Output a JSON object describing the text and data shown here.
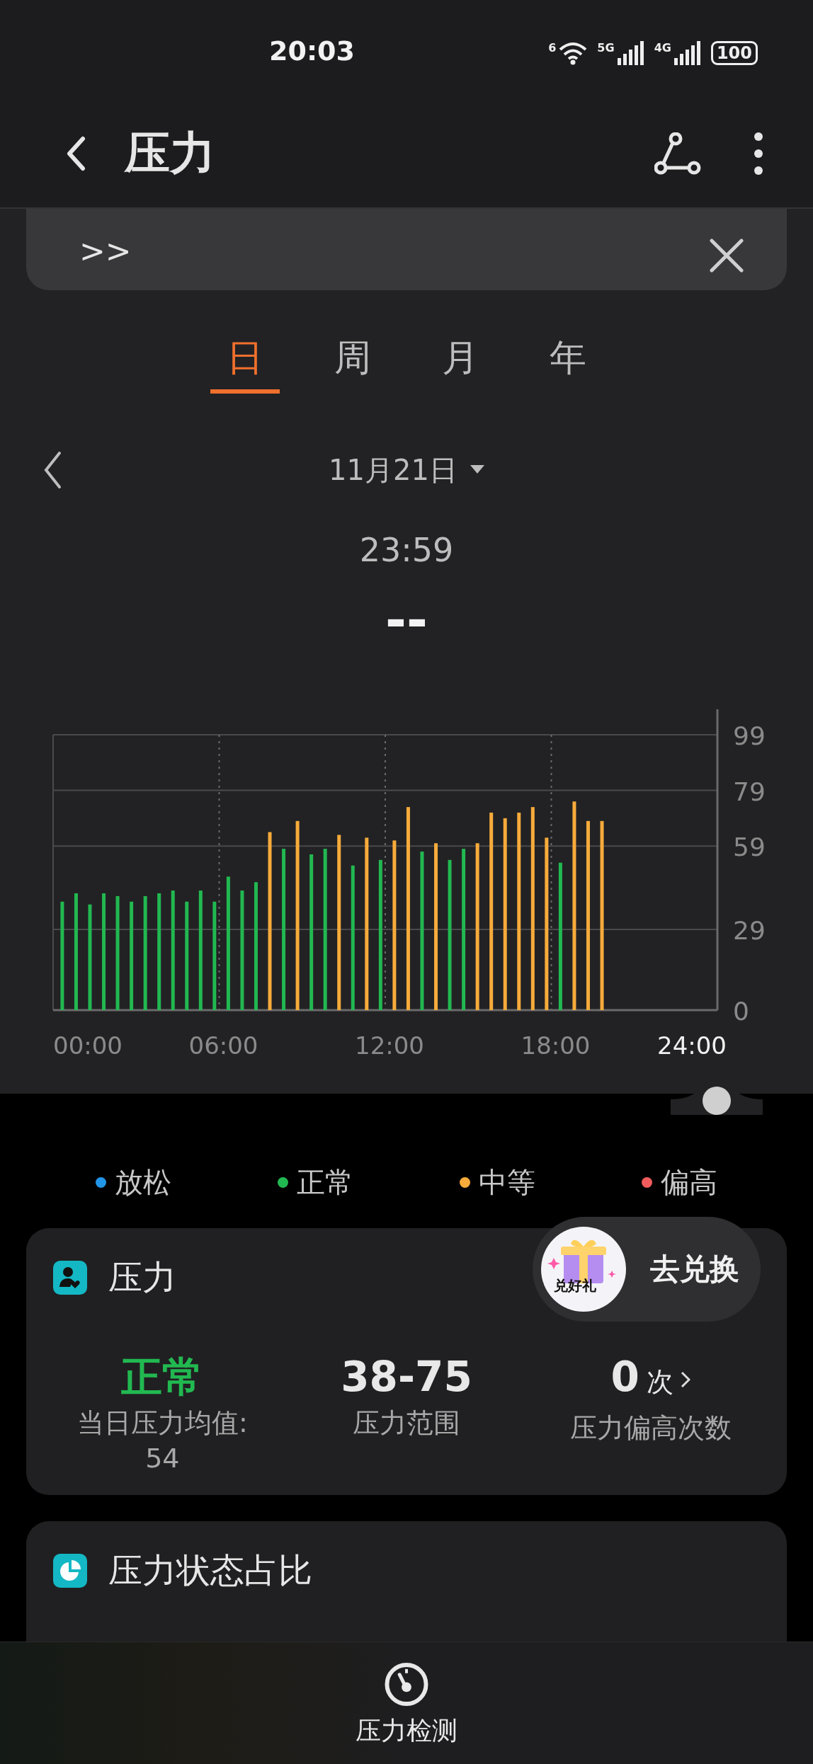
{
  "status_bar": {
    "time": "20:03",
    "wifi_badge": "6",
    "network_1": "5G",
    "network_2": "4G",
    "battery": "100"
  },
  "header": {
    "title": "压力"
  },
  "banner": {
    "link": ">>"
  },
  "tabs": [
    {
      "label": "日",
      "selected": true
    },
    {
      "label": "周",
      "selected": false
    },
    {
      "label": "月",
      "selected": false
    },
    {
      "label": "年",
      "selected": false
    }
  ],
  "date_picker": {
    "date": "11月21日"
  },
  "reading": {
    "time": "23:59",
    "value": "--"
  },
  "chart_data": {
    "type": "bar",
    "grid": true,
    "xlim": [
      0,
      24
    ],
    "ylim": [
      0,
      99
    ],
    "yticks": [
      0,
      29,
      59,
      79,
      99
    ],
    "xticks": [
      {
        "value": 0,
        "label": "00:00"
      },
      {
        "value": 6,
        "label": "06:00"
      },
      {
        "value": 12,
        "label": "12:00"
      },
      {
        "value": 18,
        "label": "18:00"
      },
      {
        "value": 24,
        "label": "24:00"
      }
    ],
    "x": [
      0.33,
      0.83,
      1.33,
      1.83,
      2.33,
      2.83,
      3.33,
      3.83,
      4.33,
      4.83,
      5.33,
      5.83,
      6.33,
      6.83,
      7.33,
      7.83,
      8.33,
      8.83,
      9.33,
      9.83,
      10.33,
      10.83,
      11.33,
      11.83,
      12.33,
      12.83,
      13.33,
      13.83,
      14.33,
      14.83,
      15.33,
      15.83,
      16.33,
      16.83,
      17.33,
      17.83,
      18.33,
      18.83,
      19.33,
      19.83
    ],
    "values": [
      39,
      42,
      38,
      42,
      41,
      39,
      41,
      42,
      43,
      39,
      43,
      39,
      48,
      43,
      46,
      64,
      58,
      68,
      56,
      58,
      63,
      52,
      62,
      54,
      61,
      73,
      57,
      60,
      54,
      58,
      60,
      71,
      69,
      71,
      73,
      62,
      53,
      75,
      68,
      68
    ]
  },
  "legend": [
    {
      "label": "放松",
      "color": "#2196e8"
    },
    {
      "label": "正常",
      "color": "#22b851"
    },
    {
      "label": "中等",
      "color": "#f7ab3b"
    },
    {
      "label": "偏高",
      "color": "#f25c5c"
    }
  ],
  "summary_card": {
    "title": "压力",
    "stats": [
      {
        "kind": "status",
        "value": "正常",
        "label": "当日压力均值:",
        "sub": "54"
      },
      {
        "kind": "plain",
        "value": "38-75",
        "label": "压力范围"
      },
      {
        "kind": "link",
        "value": "0",
        "unit": "次",
        "label": "压力偏高次数"
      }
    ]
  },
  "promo": {
    "badge": "兑好礼",
    "button": "去兑换"
  },
  "ratio_card": {
    "title": "压力状态占比"
  },
  "bottom_nav": {
    "label": "压力检测"
  }
}
